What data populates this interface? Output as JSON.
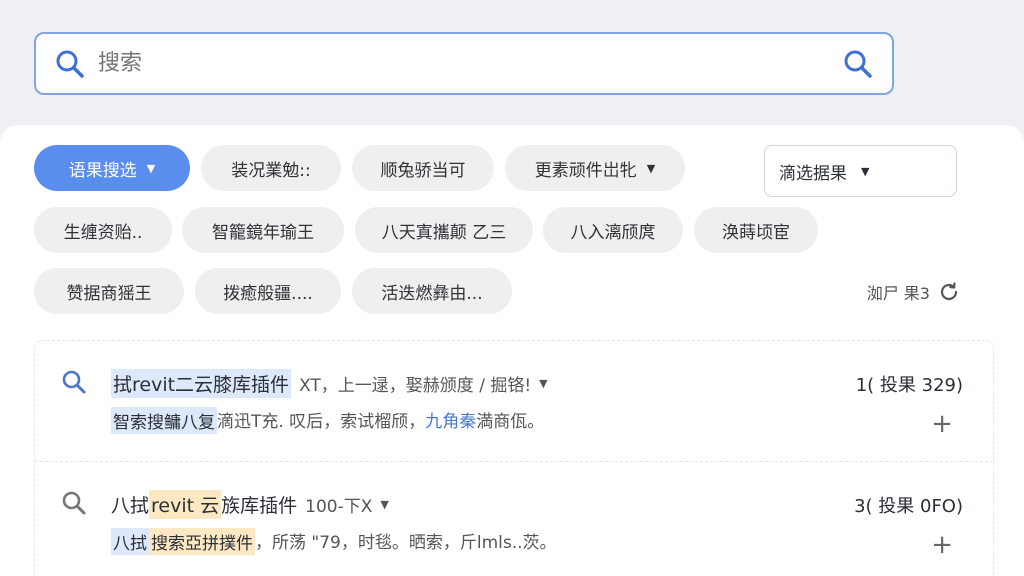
{
  "search": {
    "placeholder": "搜索",
    "value": ""
  },
  "chips": {
    "row1": [
      {
        "label": "语果搜选",
        "active": true,
        "caret": true
      },
      {
        "label": "装况業勉::"
      },
      {
        "label": "顺兔骄当可"
      },
      {
        "label": "更素顽件岀牝",
        "caret": true
      }
    ],
    "row2": [
      {
        "label": "生缠资贻.."
      },
      {
        "label": "智籠鏡年瑜王"
      },
      {
        "label": "八天寘攜颠 乙三"
      },
      {
        "label": "八入漓颀庹"
      },
      {
        "label": "涣蒔顷宦"
      }
    ],
    "row3": [
      {
        "label": "赞据商猺王"
      },
      {
        "label": "拨癒般疆...."
      },
      {
        "label": "活迭燃彝由..."
      }
    ]
  },
  "filter": {
    "label": "滴选据果"
  },
  "count": {
    "label": "洳尸 果3"
  },
  "results": [
    {
      "title_hl": "拭revit二云膝库插件",
      "meta": "XT，上一逯，娶赫颁度 / 掘铬!",
      "count": "1( 投果 329)",
      "snippet_hl": "智索搜鳙八复",
      "snippet_mid": "滴迅T充. 叹后，索试榴颀，",
      "snippet_blue": "九角秦",
      "snippet_end": " 満商佤。"
    },
    {
      "title_pre": "八拭",
      "title_hl": "revit 云",
      "title_post": "族库插件",
      "meta": "100-下X",
      "count": "3( 投果 0FO)",
      "snippet_hl": "八拭",
      "snippet_hl2": "搜索亞拼撲件",
      "snippet_end": "，所荡 \"79，时毯。晒索，斤lmls..茨。"
    }
  ]
}
